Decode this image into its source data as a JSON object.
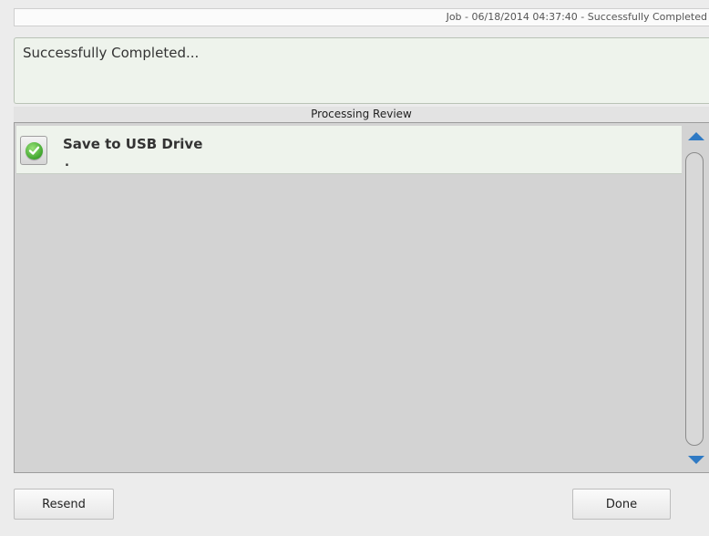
{
  "job_bar": {
    "text": "Job - 06/18/2014 04:37:40 - Successfully Completed"
  },
  "status": {
    "message": "Successfully Completed..."
  },
  "review": {
    "header": "Processing Review",
    "items": [
      {
        "title": "Save to USB Drive",
        "subtitle": ".",
        "icon": "check-circle-icon",
        "status_color": "#3fa52d"
      }
    ]
  },
  "scrollbar": {
    "up_icon": "arrow-up-icon",
    "down_icon": "arrow-down-icon",
    "arrow_color": "#2f7ac4"
  },
  "buttons": {
    "resend_label": "Resend",
    "done_label": "Done"
  }
}
